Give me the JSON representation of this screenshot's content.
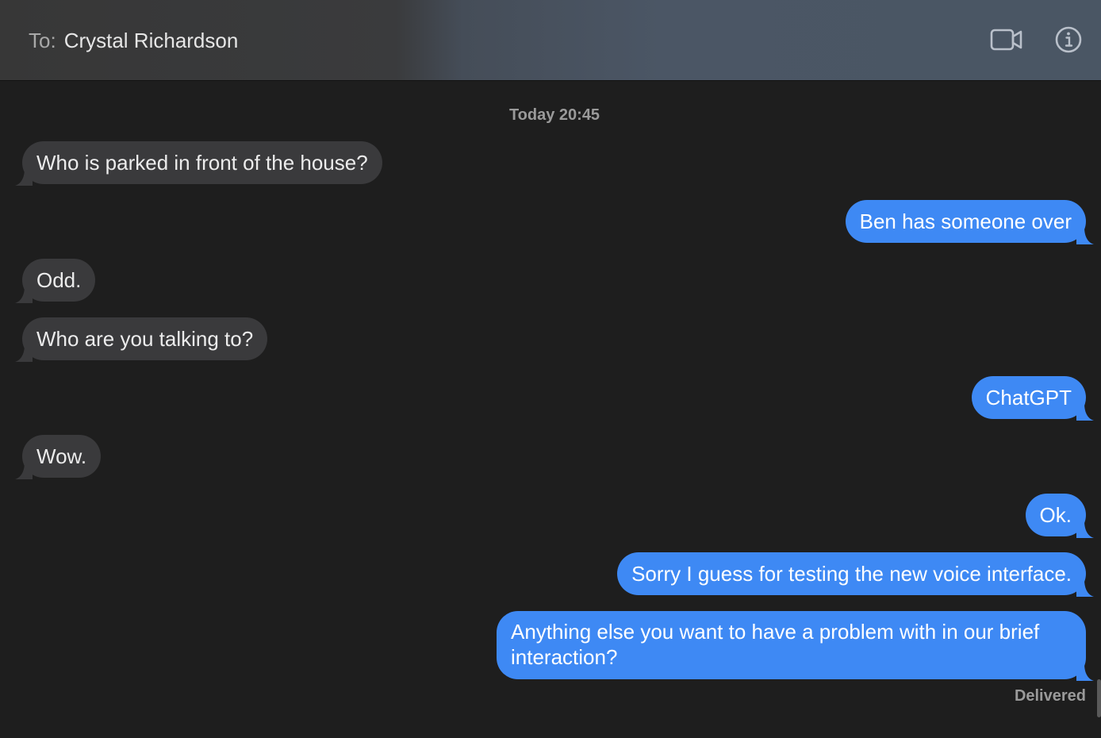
{
  "header": {
    "to_label": "To:",
    "recipient": "Crystal Richardson",
    "video_icon": "video-camera-icon",
    "info_icon": "info-circle-icon"
  },
  "conversation": {
    "timestamp": "Today 20:45",
    "messages": [
      {
        "direction": "incoming",
        "text": "Who is parked in front of the house?"
      },
      {
        "direction": "outgoing",
        "text": "Ben has someone over"
      },
      {
        "direction": "incoming",
        "text": "Odd."
      },
      {
        "direction": "incoming",
        "text": "Who are you talking to?"
      },
      {
        "direction": "outgoing",
        "text": "ChatGPT"
      },
      {
        "direction": "incoming",
        "text": "Wow."
      },
      {
        "direction": "outgoing",
        "text": "Ok."
      },
      {
        "direction": "outgoing",
        "text": "Sorry I guess for testing the new voice interface."
      },
      {
        "direction": "outgoing",
        "text": "Anything else you want to have a problem with in our brief interaction?"
      }
    ],
    "status": "Delivered"
  },
  "colors": {
    "incoming_bubble": "#3a3a3c",
    "outgoing_bubble": "#3e89f4",
    "background": "#1e1e1e"
  }
}
